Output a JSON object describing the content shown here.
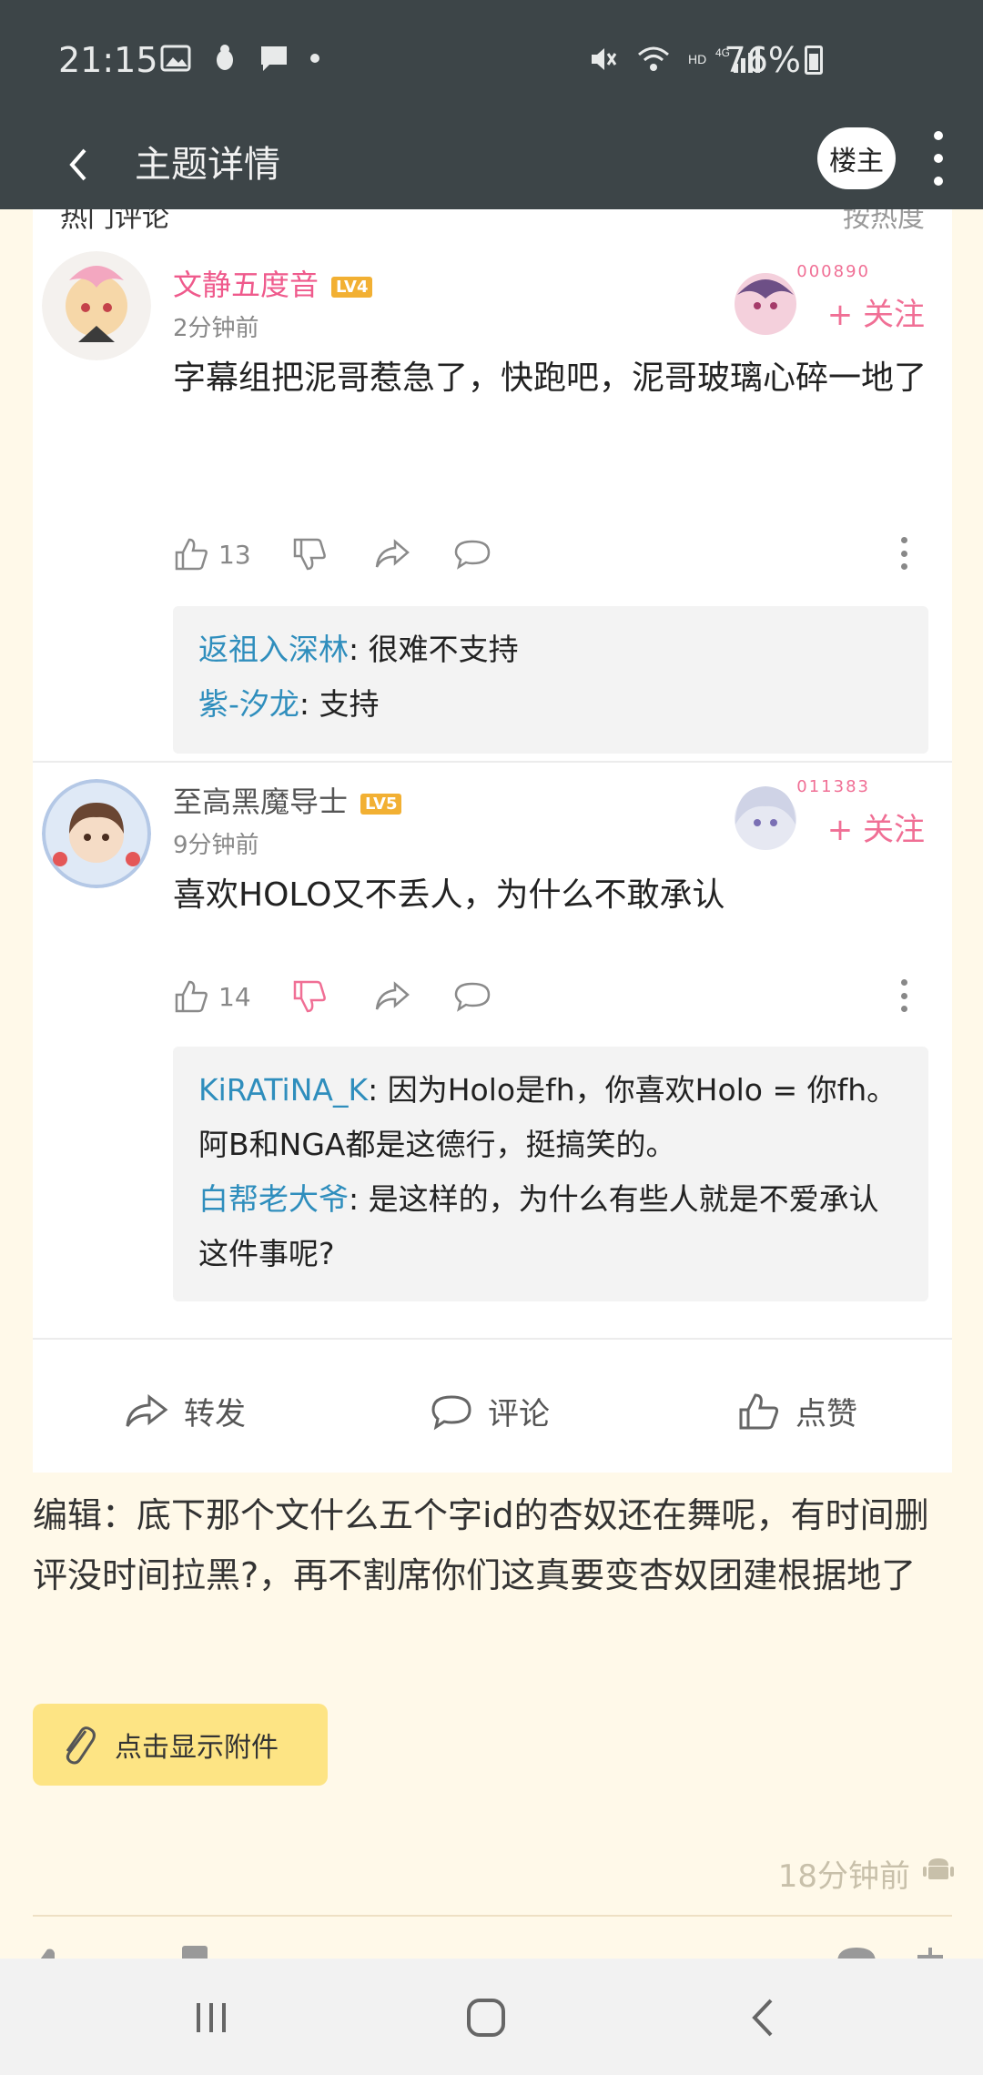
{
  "status": {
    "time": "21:15",
    "left_icons": [
      "image-icon",
      "bug-icon",
      "chat-icon",
      "dot-icon"
    ],
    "right_icons": [
      "mute-icon",
      "wifi-icon",
      "hd-4g-signal-icon"
    ],
    "battery": "76%"
  },
  "appbar": {
    "title": "主题详情",
    "op_label": "楼主"
  },
  "section": {
    "hot_comments": "热门评论",
    "sort": "按热度"
  },
  "comments": [
    {
      "user": "文静五度音",
      "level": "LV4",
      "time": "2分钟前",
      "badge_num": "000890",
      "follow": "+ 关注",
      "text": "字幕组把泥哥惹急了，快跑吧，泥哥玻璃心碎一地了",
      "likes": "13",
      "name_color": "#ef5a8c",
      "replies": [
        {
          "name": "返祖入深林",
          "text": ": 很难不支持"
        },
        {
          "name": "紫-汐龙",
          "text": ": 支持"
        }
      ]
    },
    {
      "user": "至高黑魔导士",
      "level": "LV5",
      "time": "9分钟前",
      "badge_num": "011383",
      "follow": "+ 关注",
      "text": "喜欢HOLO又不丢人，为什么不敢承认",
      "likes": "14",
      "name_color": "#555555",
      "replies": [
        {
          "name": "KiRATiNA_K",
          "text": ": 因为Holo是fh，你喜欢Holo = 你fh。阿B和NGA都是这德行，挺搞笑的。"
        },
        {
          "name": "白帮老大爷",
          "text": ": 是这样的，为什么有些人就是不爱承认这件事呢?"
        }
      ]
    }
  ],
  "bottom_actions": {
    "share": "转发",
    "comment": "评论",
    "like": "点赞"
  },
  "edit_text": "编辑：底下那个文什么五个字id的杏奴还在舞呢，有时间删评没时间拉黑?，再不割席你们这真要变杏奴团建根据地了",
  "attachment_label": "点击显示附件",
  "post_time": "18分钟前",
  "colors": {
    "appbar": "#3d4548",
    "accent_pink": "#f06f95",
    "reply_name": "#2f8ebd",
    "attach_bg": "#fde484",
    "page_bg": "#fff9e9"
  }
}
